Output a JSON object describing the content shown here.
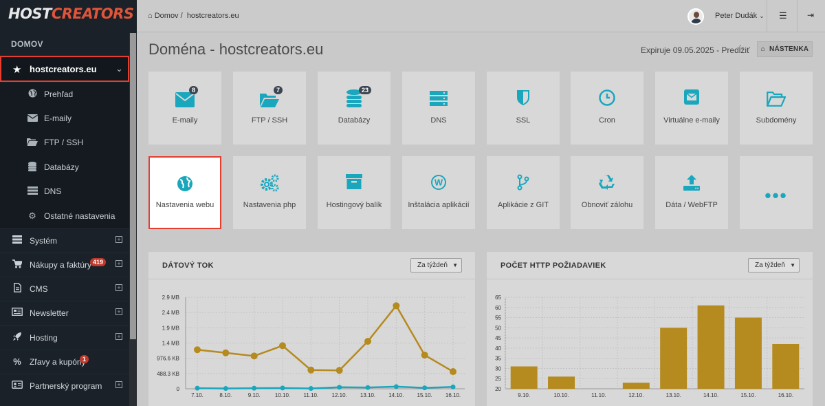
{
  "sidebar": {
    "logo_part1": "HOST",
    "logo_part2": "CREATORS",
    "section_header": "DOMOV",
    "active_domain": "hostcreators.eu",
    "sub_items": [
      {
        "label": "Prehľad",
        "icon": "globe-icon"
      },
      {
        "label": "E-maily",
        "icon": "envelope-icon"
      },
      {
        "label": "FTP / SSH",
        "icon": "folder-open-icon"
      },
      {
        "label": "Databázy",
        "icon": "database-icon"
      },
      {
        "label": "DNS",
        "icon": "server-icon"
      },
      {
        "label": "Ostatné nastavenia",
        "icon": "gear-icon"
      }
    ],
    "main_items": [
      {
        "label": "Systém",
        "icon": "server-icon",
        "badge": ""
      },
      {
        "label": "Nákupy a faktúry",
        "icon": "cart-icon",
        "badge": "419"
      },
      {
        "label": "CMS",
        "icon": "document-icon",
        "badge": ""
      },
      {
        "label": "Newsletter",
        "icon": "newspaper-icon",
        "badge": ""
      },
      {
        "label": "Hosting",
        "icon": "rocket-icon",
        "badge": ""
      },
      {
        "label": "Zľavy a kupóny",
        "icon": "percent-icon",
        "badge": "1"
      },
      {
        "label": "Partnerský program",
        "icon": "id-card-icon",
        "badge": ""
      }
    ]
  },
  "topbar": {
    "breadcrumb_home": "Domov",
    "breadcrumb_sep": "/",
    "breadcrumb_current": "hostcreators.eu",
    "username": "Peter Dudák"
  },
  "main": {
    "title": "Doména - hostcreators.eu",
    "expire_text": "Expiruje 09.05.2025 - Predĺžiť",
    "dashboard_button": "NÁSTENKA",
    "accent_color": "#1aa7bd",
    "tiles_row1": [
      {
        "label": "E-maily",
        "icon": "envelope-icon",
        "badge": "8"
      },
      {
        "label": "FTP / SSH",
        "icon": "folder-open-icon",
        "badge": "7"
      },
      {
        "label": "Databázy",
        "icon": "database-icon",
        "badge": "23"
      },
      {
        "label": "DNS",
        "icon": "server-icon",
        "badge": ""
      },
      {
        "label": "SSL",
        "icon": "shield-icon",
        "badge": ""
      },
      {
        "label": "Cron",
        "icon": "clock-icon",
        "badge": ""
      },
      {
        "label": "Virtuálne e-maily",
        "icon": "envelope-square-icon",
        "badge": ""
      },
      {
        "label": "Subdomény",
        "icon": "folder-outline-icon",
        "badge": ""
      }
    ],
    "tiles_row2": [
      {
        "label": "Nastavenia webu",
        "icon": "globe-icon"
      },
      {
        "label": "Nastavenia php",
        "icon": "gears-icon"
      },
      {
        "label": "Hostingový balík",
        "icon": "archive-icon"
      },
      {
        "label": "Inštalácia aplikácií",
        "icon": "wordpress-icon"
      },
      {
        "label": "Aplikácie z GIT",
        "icon": "git-branch-icon"
      },
      {
        "label": "Obnoviť zálohu",
        "icon": "recycle-icon"
      },
      {
        "label": "Dáta / WebFTP",
        "icon": "upload-icon"
      },
      {
        "label": "•••",
        "icon": "more-icon"
      }
    ]
  },
  "chart_data": [
    {
      "type": "line",
      "title": "DÁTOVÝ TOK",
      "period_select": "Za týždeň",
      "x": [
        "7.10.",
        "8.10.",
        "9.10.",
        "10.10.",
        "11.10.",
        "12.10.",
        "13.10.",
        "14.10.",
        "15.10.",
        "16.10."
      ],
      "y_tick_labels": [
        "0",
        "488.3 KB",
        "976.6 KB",
        "1.4 MB",
        "1.9 MB",
        "2.4 MB",
        "2.9 MB"
      ],
      "ylim_kb": [
        0,
        2929.7
      ],
      "series": [
        {
          "color": "#b58a1e",
          "values_kb": [
            1250,
            1150,
            1050,
            1380,
            600,
            590,
            1520,
            2660,
            1080,
            550
          ]
        },
        {
          "color": "#1aa7bd",
          "values_kb": [
            20,
            10,
            20,
            25,
            10,
            50,
            40,
            70,
            30,
            60
          ]
        }
      ]
    },
    {
      "type": "bar",
      "title": "POČET HTTP POŽIADAVIEK",
      "period_select": "Za týždeň",
      "categories": [
        "9.10.",
        "10.10.",
        "11.10.",
        "12.10.",
        "13.10.",
        "14.10.",
        "15.10.",
        "16.10."
      ],
      "values": [
        31,
        26,
        20,
        23,
        50,
        61,
        55,
        42
      ],
      "ylim": [
        20,
        65
      ],
      "yticks": [
        20,
        25,
        30,
        35,
        40,
        45,
        50,
        55,
        60,
        65
      ],
      "color": "#b58a1e"
    }
  ]
}
